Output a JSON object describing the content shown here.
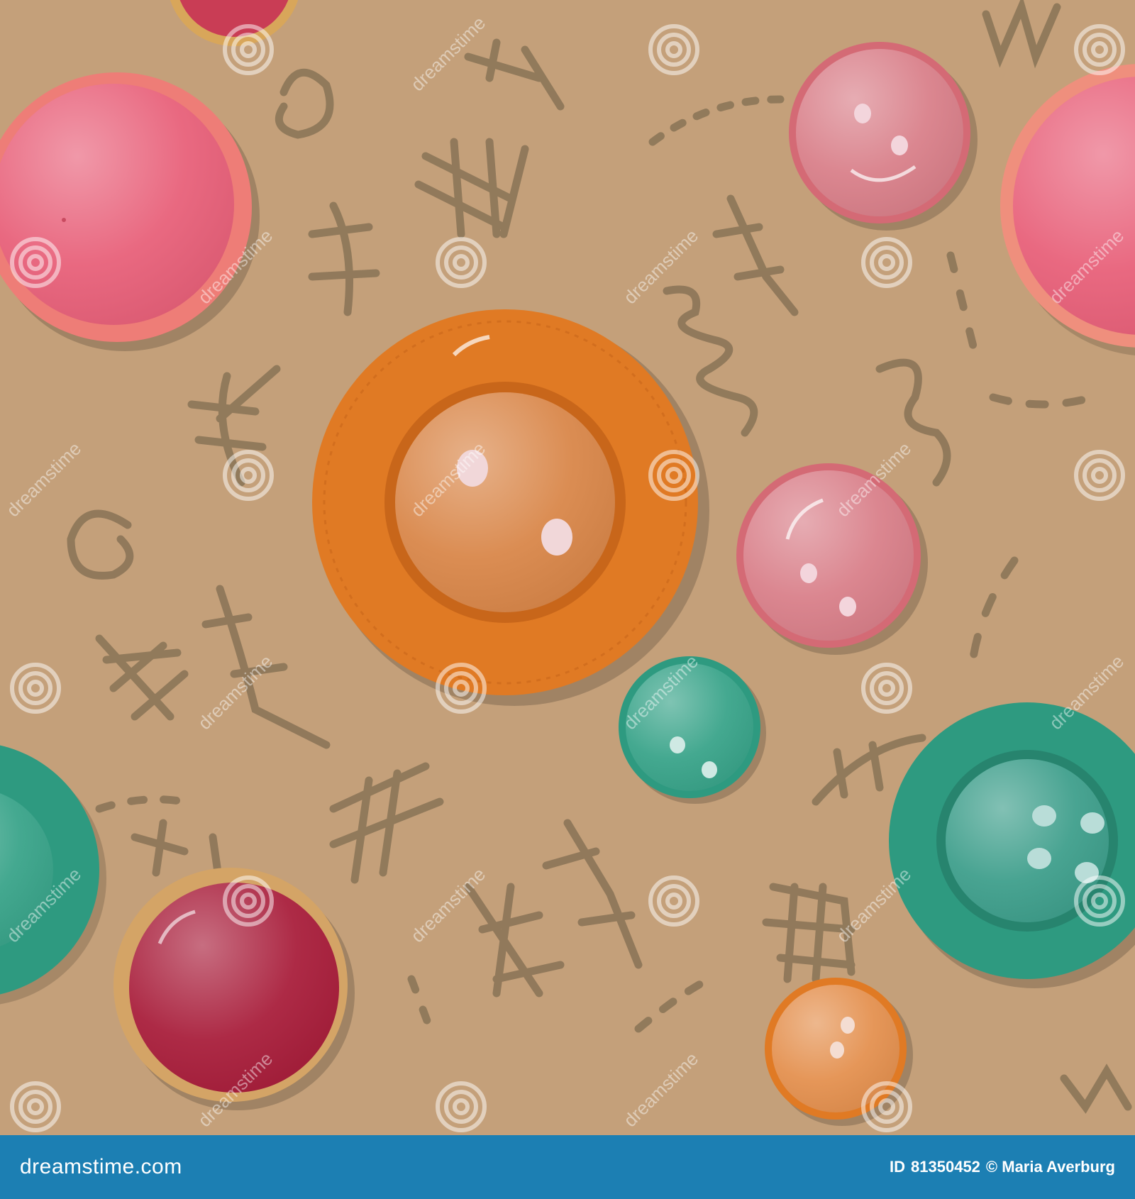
{
  "watermark": {
    "text": "dreamstime"
  },
  "footer": {
    "logo_text": "dreamstime.com",
    "id_label": "ID",
    "id_value": "81350452",
    "copyright": "© Maria Averburg"
  },
  "colors": {
    "background": "#c4a07a",
    "stitch": "#8c7558",
    "footer_bg": "#1c7fb3",
    "pink": "#e8617a",
    "orange": "#e07a24",
    "rose": "#d46a75",
    "teal": "#2e9a80",
    "crimson": "#a91f3c"
  },
  "icons": [
    "spiral-watermark-icon",
    "button-icon"
  ]
}
